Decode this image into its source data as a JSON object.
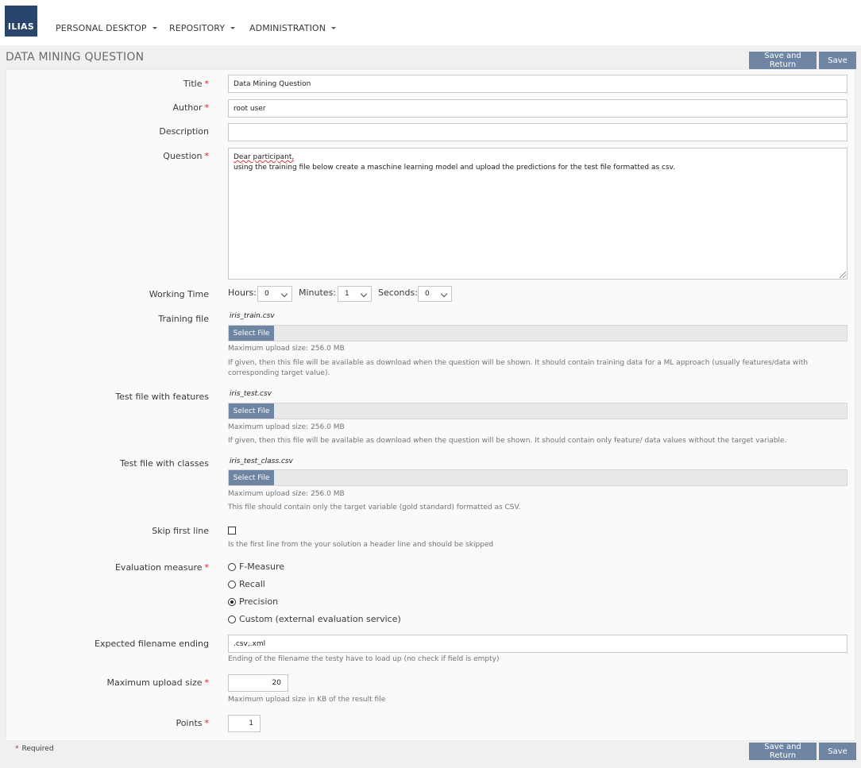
{
  "nav": {
    "logo": "ILIAS",
    "items": [
      {
        "label": "PERSONAL DESKTOP"
      },
      {
        "label": "REPOSITORY"
      },
      {
        "label": "ADMINISTRATION"
      }
    ]
  },
  "page": {
    "title": "DATA MINING QUESTION",
    "save_and_return": "Save and Return",
    "save": "Save"
  },
  "form": {
    "title": {
      "label": "Title",
      "value": "Data Mining Question"
    },
    "author": {
      "label": "Author",
      "value": "root user"
    },
    "description": {
      "label": "Description",
      "value": ""
    },
    "question": {
      "label": "Question",
      "line1": "Dear participant,",
      "line2": "using the training file below create a maschine learning model and upload the predictions for the test file formatted as csv."
    },
    "working_time": {
      "label": "Working Time",
      "hours_label": "Hours:",
      "hours": "0",
      "minutes_label": "Minutes:",
      "minutes": "1",
      "seconds_label": "Seconds:",
      "seconds": "0"
    },
    "training_file": {
      "label": "Training file",
      "filename": "iris_train.csv",
      "button": "Select File",
      "max_size": "Maximum upload size: 256.0 MB",
      "help": "If given, then this file will be available as download when the question will be shown. It should contain training data for a ML approach (usually features/data with corresponding target value)."
    },
    "test_file": {
      "label": "Test file with features",
      "filename": "iris_test.csv",
      "button": "Select File",
      "max_size": "Maximum upload size: 256.0 MB",
      "help": "If given, then this file will be available as download when the question will be shown. It should contain only feature/ data values without the target variable."
    },
    "class_file": {
      "label": "Test file with classes",
      "filename": "iris_test_class.csv",
      "button": "Select File",
      "max_size": "Maximum upload size: 256.0 MB",
      "help": "This file should contain only the target variable (gold standard) formatted as CSV."
    },
    "skip_first_line": {
      "label": "Skip first line",
      "checked": false,
      "help": "Is the first line from the your solution a header line and should be skipped"
    },
    "evaluation": {
      "label": "Evaluation measure",
      "options": [
        "F-Measure",
        "Recall",
        "Precision",
        "Custom (external evaluation service)"
      ],
      "selected": "Precision"
    },
    "filename_ending": {
      "label": "Expected filename ending",
      "value": ".csv,.xml",
      "help": "Ending of the filename the testy have to load up (no check if field is empty)"
    },
    "max_upload": {
      "label": "Maximum upload size",
      "value": "20",
      "help": "Maximum upload size in KB of the result file"
    },
    "points": {
      "label": "Points",
      "value": "1"
    },
    "required_star": "*",
    "required_note": "Required"
  }
}
